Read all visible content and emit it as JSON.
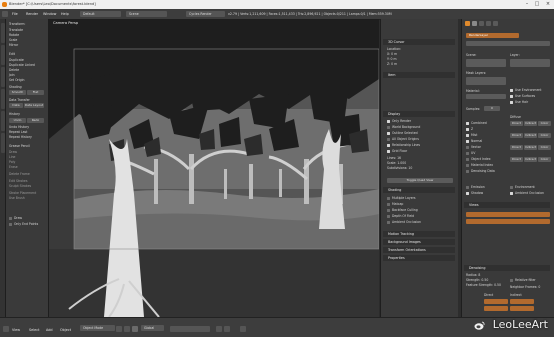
{
  "window": {
    "title": "Blender* [C:\\Users\\Leo\\Documents\\forest.blend]"
  },
  "menubar": {
    "items": [
      "File",
      "Render",
      "Window",
      "Help"
    ],
    "layout": "Default",
    "scene": "Scene",
    "engine": "Cycles Render",
    "stats": "v2.79 | Verts:1,211,609 | Faces:1,511,433 | Tris:2,896,921 | Objects:0/211 | Lamps:0/1 | Mem:559.30M"
  },
  "toolshelf": {
    "lines": [
      "Transform:",
      "Translate",
      "Rotate",
      "Scale",
      "Mirror",
      "Edit",
      "Duplicate",
      "Duplicate Linked",
      "Delete",
      "Join",
      "Set Origin",
      "Shading",
      "Smooth",
      "Flat",
      "Data Transfer",
      "Data",
      "Data Layout",
      "History",
      "Undo",
      "Redo",
      "Undo History",
      "Repeat Last",
      "Repeat History",
      "Grease Pencil",
      "Draw",
      "Line",
      "Poly",
      "Erase",
      "Delete Frame",
      "Edit Strokes",
      "Sculpt Strokes",
      "Stroke Placement",
      "Use Brush"
    ],
    "bottom_lines": [
      "Draw",
      "Only End Points"
    ]
  },
  "viewport": {
    "title": "Camera Persp"
  },
  "nprops": {
    "sections": [
      "3D Cursor",
      "Item",
      "Display",
      "Shading",
      "Motion Tracking",
      "Background Images",
      "Transform Orientations",
      "Properties"
    ],
    "lines": [
      "Location:",
      "X: 0 m",
      "Y: 0 m",
      "Z: 0 m",
      "Only Render",
      "World Background",
      "Outline Selected",
      "All Object Origins",
      "Relationship Lines",
      "Grid Floor",
      "Lines: 16",
      "Scale: 1.000",
      "Subdivisions: 10",
      "Toggle Quad View",
      "Multiple Layers",
      "Matcap",
      "Backface Culling",
      "Depth Of Field",
      "Ambient Occlusion",
      "Camera",
      "Lock Camera to View",
      "Lamp"
    ]
  },
  "propeditor": {
    "renderlayer": "RenderLayer",
    "scene_label": "Scene:",
    "layer_label": "Layer:",
    "mask_layers": "Mask Layers:",
    "material_override": "Material:",
    "samples_label": "Samples:",
    "samples": "0",
    "passes": [
      "Combined",
      "Z",
      "Mist",
      "Normal",
      "Vector",
      "UV",
      "Object Index",
      "Material Index",
      "Denoising Data"
    ],
    "diffuse": [
      "Direct",
      "Indirect",
      "Color"
    ],
    "glossy": [
      "Direct",
      "Indirect",
      "Color"
    ],
    "transmission": [
      "Direct",
      "Indirect",
      "Color"
    ],
    "subsurface": [
      "Direct",
      "Indirect",
      "Color"
    ],
    "emission": "Emission",
    "environment": "Environment",
    "shadow": "Shadow",
    "ao": "Ambient Occlusion",
    "views": "Views",
    "denoising": "Denoising",
    "radius": "Radius: 8",
    "strength": "Strength: 0.50",
    "feature_strength": "Feature Strength: 0.50",
    "relative_filter": "Relative filter",
    "neighbor_frames": "Neighbor Frames: 0",
    "diff_label": "Diffuse",
    "direct_label": "Direct",
    "indirect_label": "Indirect",
    "use_environment": "Use Environment",
    "use_surfaces": "Use Surfaces",
    "use_hair": "Use Hair"
  },
  "bottombar": {
    "items": [
      "View",
      "Select",
      "Add",
      "Object",
      "Object Mode",
      "Global"
    ]
  },
  "watermark": {
    "text": "LeoLeeArt"
  }
}
